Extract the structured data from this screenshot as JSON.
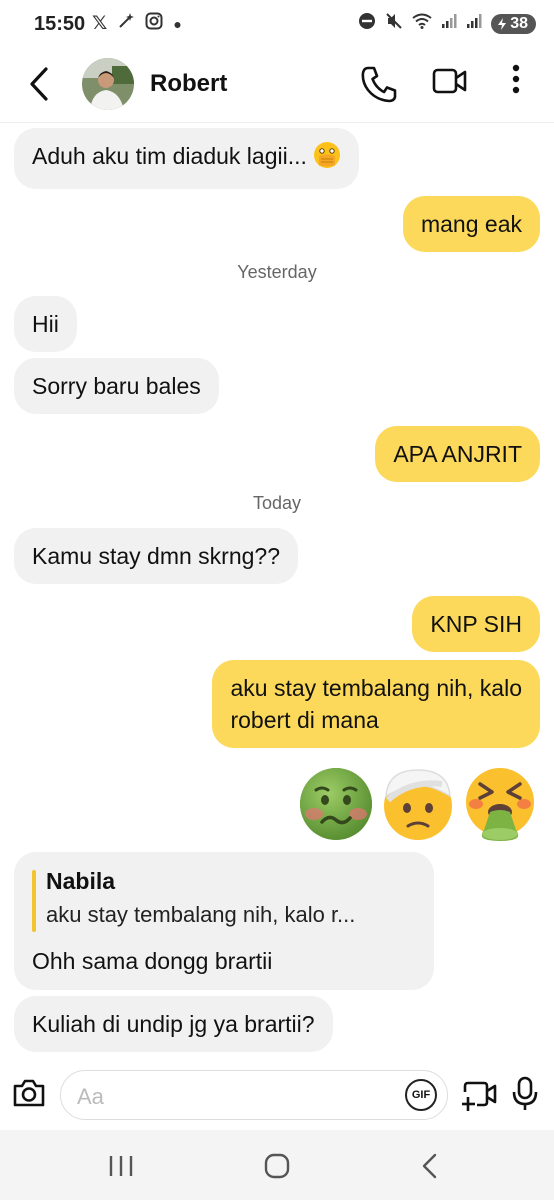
{
  "status_bar": {
    "time": "15:50",
    "battery": "38",
    "icons": [
      "x-icon",
      "magic-wand-icon",
      "instagram-icon",
      "dot-icon",
      "do-not-disturb-icon",
      "mute-icon",
      "wifi-icon",
      "signal-icon",
      "signal-icon",
      "battery-icon"
    ]
  },
  "header": {
    "contact_name": "Robert",
    "icons": [
      "back-icon",
      "phone-icon",
      "video-call-icon",
      "more-icon"
    ]
  },
  "conversation": {
    "messages": [
      {
        "side": "in",
        "text": "Aduh aku tim diaduk lagii...",
        "emoji": "face-with-open-eyes-and-hand-over-mouth"
      },
      {
        "side": "out",
        "text": "mang eak"
      },
      {
        "side": "timestamp",
        "text": "Yesterday"
      },
      {
        "side": "in",
        "text": "Hii"
      },
      {
        "side": "in",
        "text": "Sorry baru bales"
      },
      {
        "side": "out",
        "text": "APA ANJRIT"
      },
      {
        "side": "timestamp",
        "text": "Today"
      },
      {
        "side": "in",
        "text": "Kamu stay dmn skrng??"
      },
      {
        "side": "out",
        "text": "KNP SIH"
      },
      {
        "side": "out",
        "lines": [
          "aku stay tembalang nih, kalo",
          "robert di mana"
        ]
      },
      {
        "side": "out",
        "emojis": [
          "nauseated-face",
          "face-with-head-bandage",
          "face-vomiting"
        ]
      },
      {
        "side": "in",
        "reply_to": {
          "name": "Nabila",
          "text": "aku stay tembalang nih, kalo r..."
        },
        "text": "Ohh sama dongg brartii"
      },
      {
        "side": "in",
        "text": "Kuliah di undip jg ya brartii?"
      }
    ]
  },
  "composer": {
    "placeholder": "Aa",
    "gif_label": "GIF",
    "icons": [
      "camera-icon",
      "gif-icon",
      "video-clip-icon",
      "mic-icon"
    ]
  },
  "nav_bar": {
    "icons": [
      "recent-apps-icon",
      "home-icon",
      "back-icon"
    ]
  },
  "colors": {
    "outgoing_bubble": "#fcd95a",
    "incoming_bubble": "#f1f1f2",
    "reply_bar": "#f3c531"
  }
}
